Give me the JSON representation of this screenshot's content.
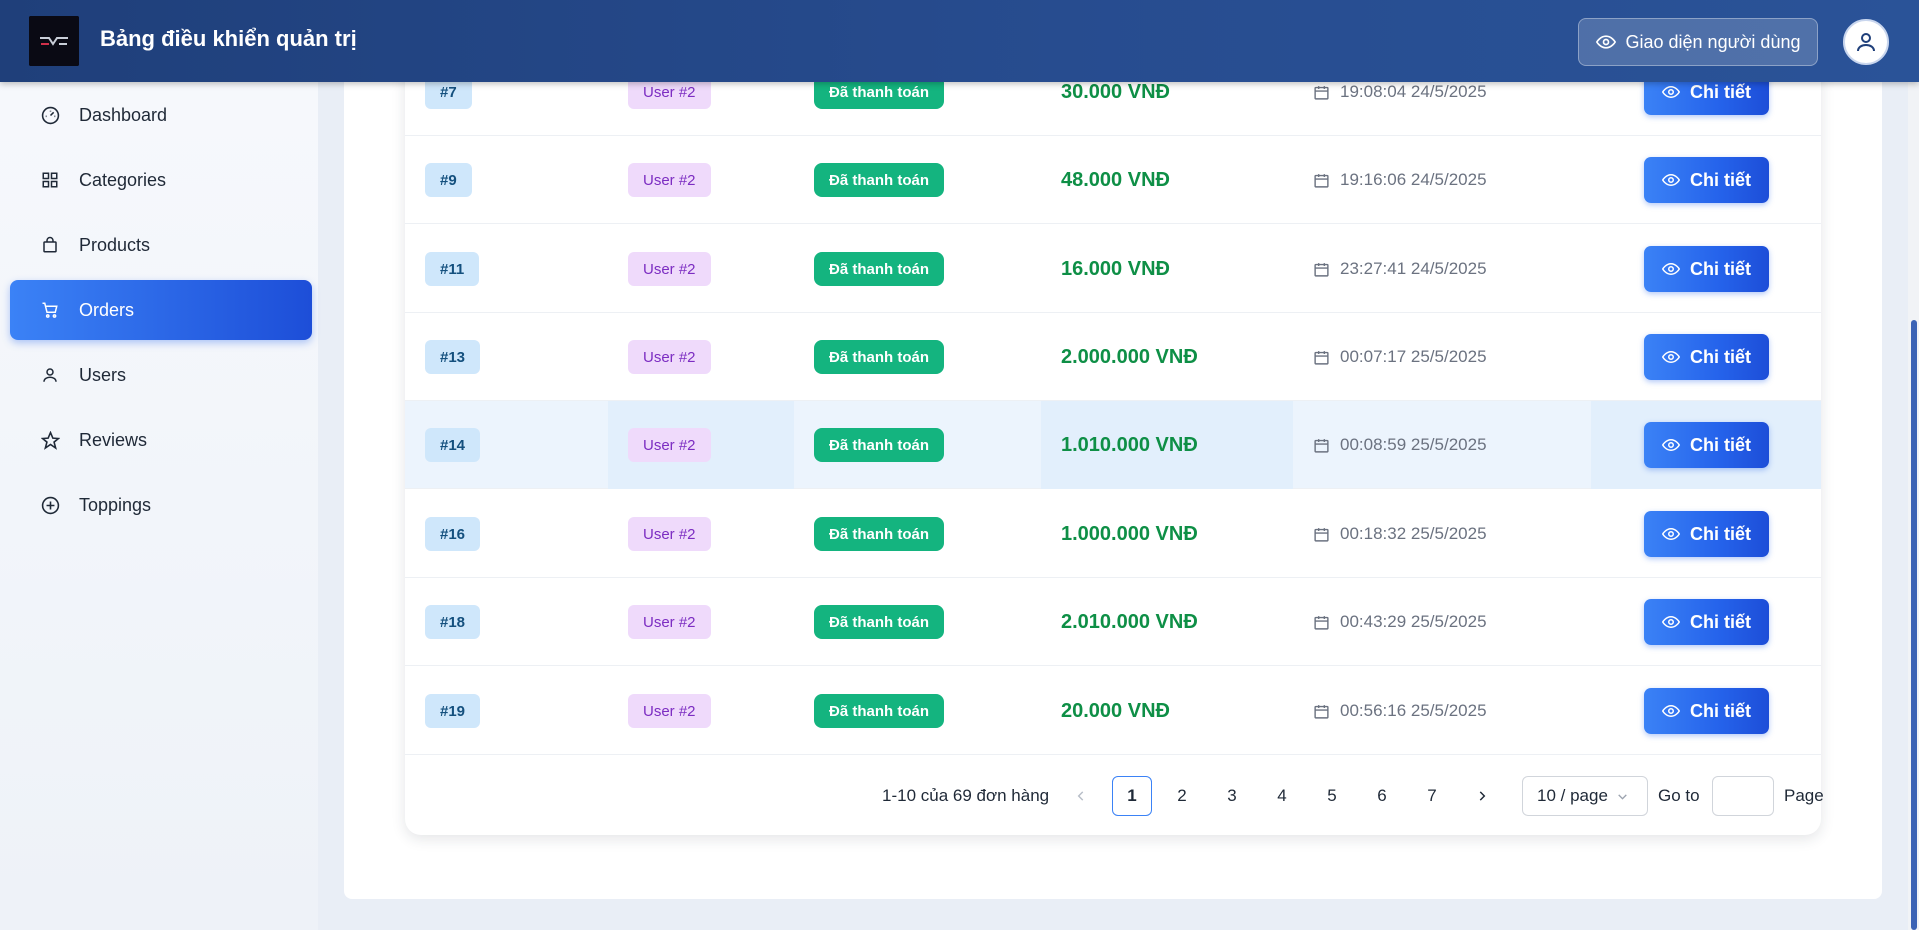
{
  "header": {
    "title": "Bảng điều khiển quản trị",
    "user_view_label": "Giao diện người dùng"
  },
  "sidebar": {
    "items": [
      {
        "label": "Dashboard",
        "icon": "dashboard-icon"
      },
      {
        "label": "Categories",
        "icon": "grid-icon"
      },
      {
        "label": "Products",
        "icon": "bag-icon"
      },
      {
        "label": "Orders",
        "icon": "cart-icon",
        "active": true
      },
      {
        "label": "Users",
        "icon": "user-icon"
      },
      {
        "label": "Reviews",
        "icon": "star-icon"
      },
      {
        "label": "Toppings",
        "icon": "plus-circle-icon"
      }
    ]
  },
  "orders": {
    "rows": [
      {
        "id": "#7",
        "user": "User #2",
        "status": "Đã thanh toán",
        "amount": "30.000 VNĐ",
        "date": "19:08:04 24/5/2025",
        "action": "Chi tiết"
      },
      {
        "id": "#9",
        "user": "User #2",
        "status": "Đã thanh toán",
        "amount": "48.000 VNĐ",
        "date": "19:16:06 24/5/2025",
        "action": "Chi tiết"
      },
      {
        "id": "#11",
        "user": "User #2",
        "status": "Đã thanh toán",
        "amount": "16.000 VNĐ",
        "date": "23:27:41 24/5/2025",
        "action": "Chi tiết"
      },
      {
        "id": "#13",
        "user": "User #2",
        "status": "Đã thanh toán",
        "amount": "2.000.000 VNĐ",
        "date": "00:07:17 25/5/2025",
        "action": "Chi tiết"
      },
      {
        "id": "#14",
        "user": "User #2",
        "status": "Đã thanh toán",
        "amount": "1.010.000 VNĐ",
        "date": "00:08:59 25/5/2025",
        "action": "Chi tiết",
        "highlighted": true
      },
      {
        "id": "#16",
        "user": "User #2",
        "status": "Đã thanh toán",
        "amount": "1.000.000 VNĐ",
        "date": "00:18:32 25/5/2025",
        "action": "Chi tiết"
      },
      {
        "id": "#18",
        "user": "User #2",
        "status": "Đã thanh toán",
        "amount": "2.010.000 VNĐ",
        "date": "00:43:29 25/5/2025",
        "action": "Chi tiết"
      },
      {
        "id": "#19",
        "user": "User #2",
        "status": "Đã thanh toán",
        "amount": "20.000 VNĐ",
        "date": "00:56:16 25/5/2025",
        "action": "Chi tiết"
      }
    ]
  },
  "pagination": {
    "total_text": "1-10 của 69 đơn hàng",
    "pages": [
      "1",
      "2",
      "3",
      "4",
      "5",
      "6",
      "7"
    ],
    "current_page": "1",
    "page_size": "10 / page",
    "goto_label": "Go to",
    "page_label": "Page"
  },
  "colors": {
    "header": "#274c8f",
    "active_nav": "#2563eb",
    "paid_status": "#14b47f",
    "amount": "#0e8f46",
    "id_badge": "#cfe7fb",
    "user_badge": "#efdafb"
  }
}
